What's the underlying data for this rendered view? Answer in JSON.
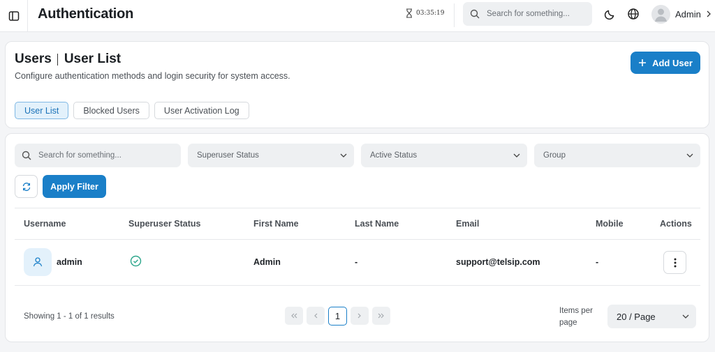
{
  "header": {
    "title": "Authentication",
    "clock": "03:35:19",
    "search_placeholder": "Search for something...",
    "user_name": "Admin"
  },
  "page": {
    "title_section": "Users",
    "title_page": "User List",
    "subtitle": "Configure authentication methods and login security for system access.",
    "add_button": "Add User",
    "tabs": [
      {
        "label": "User List",
        "active": true
      },
      {
        "label": "Blocked Users",
        "active": false
      },
      {
        "label": "User Activation Log",
        "active": false
      }
    ]
  },
  "filters": {
    "search_placeholder": "Search for something...",
    "superuser_status": "Superuser Status",
    "active_status": "Active Status",
    "group": "Group",
    "apply_label": "Apply Filter"
  },
  "table": {
    "columns": [
      "Username",
      "Superuser Status",
      "First Name",
      "Last Name",
      "Email",
      "Mobile",
      "Actions"
    ],
    "rows": [
      {
        "username": "admin",
        "superuser": true,
        "first_name": "Admin",
        "last_name": "-",
        "email": "support@telsip.com",
        "mobile": "-"
      }
    ]
  },
  "pagination": {
    "summary": "Showing 1 - 1 of 1 results",
    "current_page": "1",
    "items_per_page_label": "Items per page",
    "items_per_page_value": "20 / Page"
  },
  "colors": {
    "accent": "#1a7fc8",
    "success": "#2aa58a"
  }
}
